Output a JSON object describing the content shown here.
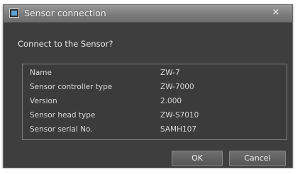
{
  "window": {
    "title": "Sensor connection",
    "close_glyph": "×",
    "icon": "sensor-app-icon"
  },
  "prompt": "Connect to the Sensor?",
  "info": [
    {
      "label": "Name",
      "value": "ZW-7"
    },
    {
      "label": "Sensor controller type",
      "value": "ZW-7000"
    },
    {
      "label": "Version",
      "value": "2.000"
    },
    {
      "label": "Sensor head type",
      "value": "ZW-S7010"
    },
    {
      "label": "Sensor serial No.",
      "value": "SAMH107"
    }
  ],
  "buttons": {
    "ok": "OK",
    "cancel": "Cancel"
  },
  "colors": {
    "dialog_bg": "#3e3e3e",
    "titlebar": "#7c7c7c",
    "text": "#e8e8e8"
  }
}
